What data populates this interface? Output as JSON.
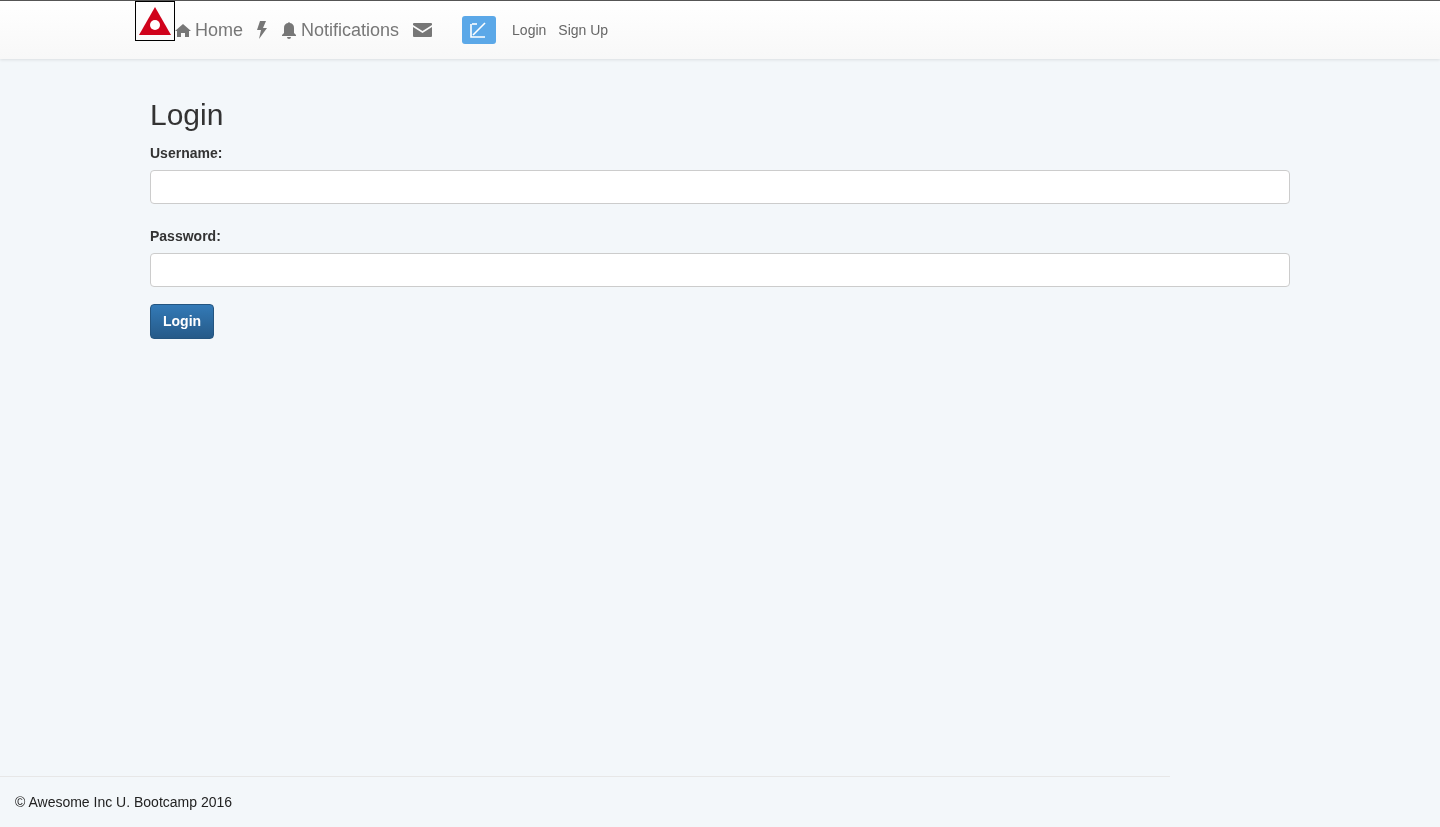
{
  "navbar": {
    "items": [
      {
        "kind": "logo"
      },
      {
        "kind": "home",
        "label": "Home"
      },
      {
        "kind": "bolt"
      },
      {
        "kind": "bell",
        "label": "Notifications"
      },
      {
        "kind": "envelope"
      },
      {
        "kind": "compose"
      },
      {
        "kind": "link",
        "label": "Login"
      },
      {
        "kind": "link",
        "label": "Sign Up"
      }
    ]
  },
  "form": {
    "title": "Login",
    "fields": [
      {
        "label": "Username:"
      },
      {
        "label": "Password:"
      }
    ],
    "submit": "Login"
  },
  "footer": {
    "text": "© Awesome Inc U. Bootcamp 2016"
  }
}
